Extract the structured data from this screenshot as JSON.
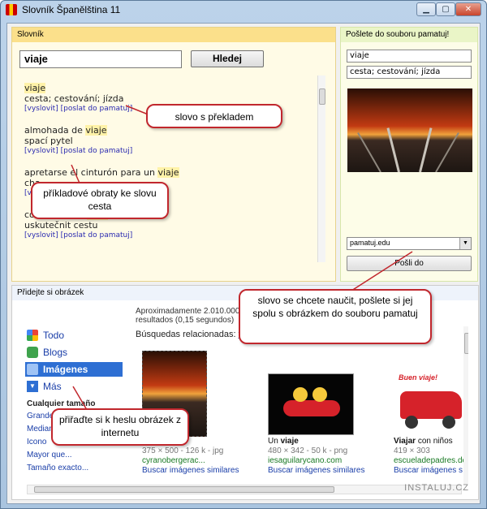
{
  "window": {
    "title": "Slovník Španělština 11"
  },
  "slovnik": {
    "panel_title": "Slovník",
    "search_value": "viaje",
    "search_button": "Hledej",
    "entries": [
      {
        "word_pre": "",
        "word_hl": "viaje",
        "word_post": "",
        "translation": "cesta; cestování; jízda",
        "link1": "[vyslovit]",
        "link2": "[poslat do pamatuj]"
      },
      {
        "word_pre": "almohada de ",
        "word_hl": "viaje",
        "word_post": "",
        "translation": "spací pytel",
        "link1": "[vyslovit]",
        "link2": "[poslat do pamatuj]"
      },
      {
        "word_pre": "apretarse el cinturón para un ",
        "word_hl": "viaje",
        "word_post": "",
        "translation": "cha",
        "link1": "[vyslovit]",
        "link2": ""
      },
      {
        "word_pre": "completar un ",
        "word_hl": "viaje",
        "word_post": "",
        "translation": "uskutečnit cestu",
        "link1": "[vyslovit]",
        "link2": "[poslat do pamatuj]"
      }
    ]
  },
  "poslete": {
    "panel_title": "Pošlete do souboru pamatuj!",
    "word_value": "viaje",
    "translation_value": "cesta; cestování; jízda",
    "file_select": "pamatuj.edu",
    "send_button": "Pošli do"
  },
  "pridejte": {
    "panel_title": "Přidejte si obrázek",
    "nav": {
      "todo": "Todo",
      "blogs": "Blogs",
      "images": "Imágenes",
      "more": "Más"
    },
    "filters_title": "Cualquier tamaño",
    "filters": [
      "Grande",
      "Mediano",
      "Icono",
      "Mayor que...",
      "Tamaño exacto..."
    ],
    "results_line1": "Aproximadamente 2.010.000",
    "results_line2": "resultados (0,15 segundos)",
    "related_label": "Búsquedas relacionadas:",
    "related_value": "viaje",
    "images": [
      {
        "title_pre": "",
        "title_bold": "",
        "meta": "375 × 500 - 126 k - jpg",
        "site": "cyranobergerac...",
        "link": "Buscar imágenes similares"
      },
      {
        "title_pre": "Un ",
        "title_bold": "viaje",
        "meta": "480 × 342 - 50 k - png",
        "site": "iesaguilarycano.com",
        "link": "Buscar imágenes similares"
      },
      {
        "title_pre": "Viajar",
        "title_bold": " con niños",
        "meta": "419 × 303",
        "site": "escueladepadres.de",
        "link": "Buscar imágenes s"
      }
    ],
    "badge_text": "Buen viaje!"
  },
  "callouts": {
    "word_translation": "slovo s překladem",
    "phrases": "příkladové obraty ke slovu cesta",
    "send_tip": "slovo se chcete naučit, pošlete si jej spolu s obrázkem do souboru pamatuj",
    "image_tip": "přiřaďte si k heslu obrázek z internetu"
  },
  "watermark": "INSTALUJ.CZ",
  "colors": {
    "highlight": "#fff2a8",
    "callout_border": "#c1272d",
    "link": "#2a2ab0",
    "google_active": "#2e6fd3"
  }
}
